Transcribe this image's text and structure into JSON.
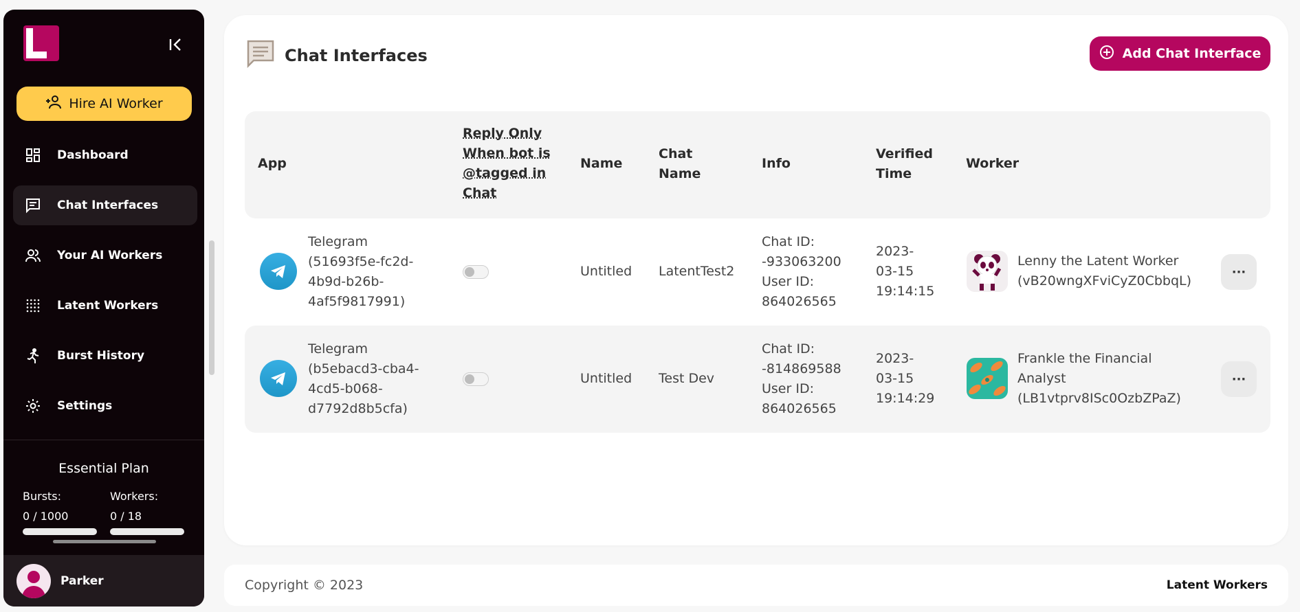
{
  "sidebar": {
    "hire_label": "Hire AI Worker",
    "items": [
      {
        "label": "Dashboard",
        "icon": "dashboard-icon"
      },
      {
        "label": "Chat Interfaces",
        "icon": "chat-icon",
        "active": true
      },
      {
        "label": "Your AI Workers",
        "icon": "people-icon"
      },
      {
        "label": "Latent Workers",
        "icon": "grid-dots-icon"
      },
      {
        "label": "Burst History",
        "icon": "running-icon"
      },
      {
        "label": "Settings",
        "icon": "gear-icon"
      }
    ],
    "plan": {
      "title": "Essential Plan",
      "bursts_label": "Bursts:",
      "bursts_value": "0 / 1000",
      "bursts_fraction": 0,
      "workers_label": "Workers:",
      "workers_value": "0 / 18",
      "workers_fraction": 0
    },
    "user": {
      "name": "Parker"
    }
  },
  "page": {
    "title": "Chat Interfaces",
    "add_button": "Add Chat Interface"
  },
  "table": {
    "headers": {
      "app": "App",
      "reply": [
        "Reply Only",
        "When bot is",
        "@tagged in",
        "Chat"
      ],
      "name": "Name",
      "chat_name": [
        "Chat",
        "Name"
      ],
      "info": "Info",
      "verified": [
        "Verified",
        "Time"
      ],
      "worker": "Worker"
    },
    "rows": [
      {
        "app": [
          "Telegram",
          "(51693f5e-fc2d-",
          "4b9d-b26b-",
          "4af5f9817991)"
        ],
        "reply_only": false,
        "name": "Untitled",
        "chat_name": "LatentTest2",
        "info": [
          "Chat ID:",
          "-933063200",
          "User ID:",
          "864026565"
        ],
        "verified": [
          "2023-",
          "03-15",
          "19:14:15"
        ],
        "worker": [
          "Lenny the Latent Worker",
          "(vB20wngXFviCyZ0CbbqL)"
        ]
      },
      {
        "app": [
          "Telegram",
          "(b5ebacd3-cba4-",
          "4cd5-b068-",
          "d7792d8b5cfa)"
        ],
        "reply_only": false,
        "name": "Untitled",
        "chat_name": "Test Dev",
        "info": [
          "Chat ID:",
          "-814869588",
          "User ID:",
          "864026565"
        ],
        "verified": [
          "2023-",
          "03-15",
          "19:14:29"
        ],
        "worker": [
          "Frankle the Financial",
          "Analyst",
          "(LB1vtprv8ISc0OzbZPaZ)"
        ]
      }
    ],
    "more_label": "···"
  },
  "footer": {
    "copyright": "Copyright © 2023",
    "brand": "Latent Workers"
  },
  "colors": {
    "brand": "#b5075f",
    "hire": "#ffcb4c",
    "sidebar_bg": "#0d0408",
    "telegram": "#2aa3dc"
  }
}
